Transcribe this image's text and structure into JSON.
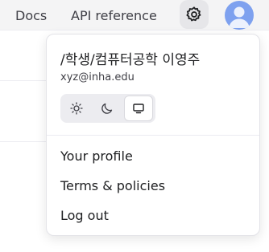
{
  "header": {
    "links": [
      "Docs",
      "API reference"
    ],
    "settings_icon": "gear-icon",
    "avatar_icon": "user-avatar-icon",
    "accent": "#7ea1ef"
  },
  "account_menu": {
    "user_name": "/학생/컴퓨터공학 이영주",
    "email": "xyz@inha.edu",
    "theme": {
      "options": [
        "light",
        "dark",
        "system"
      ],
      "icons": [
        "sun-icon",
        "moon-icon",
        "monitor-icon"
      ],
      "selected": "system"
    },
    "items": [
      "Your profile",
      "Terms & policies",
      "Log out"
    ]
  }
}
